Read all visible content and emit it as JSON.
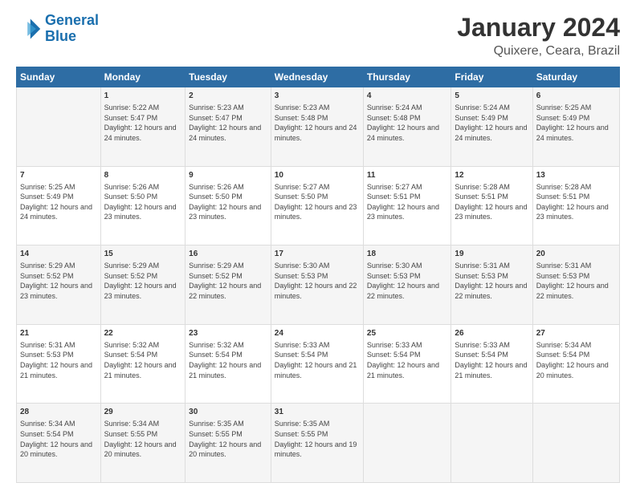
{
  "header": {
    "logo_line1": "General",
    "logo_line2": "Blue",
    "title": "January 2024",
    "subtitle": "Quixere, Ceara, Brazil"
  },
  "columns": [
    "Sunday",
    "Monday",
    "Tuesday",
    "Wednesday",
    "Thursday",
    "Friday",
    "Saturday"
  ],
  "weeks": [
    [
      {
        "day": "",
        "sunrise": "",
        "sunset": "",
        "daylight": ""
      },
      {
        "day": "1",
        "sunrise": "Sunrise: 5:22 AM",
        "sunset": "Sunset: 5:47 PM",
        "daylight": "Daylight: 12 hours and 24 minutes."
      },
      {
        "day": "2",
        "sunrise": "Sunrise: 5:23 AM",
        "sunset": "Sunset: 5:47 PM",
        "daylight": "Daylight: 12 hours and 24 minutes."
      },
      {
        "day": "3",
        "sunrise": "Sunrise: 5:23 AM",
        "sunset": "Sunset: 5:48 PM",
        "daylight": "Daylight: 12 hours and 24 minutes."
      },
      {
        "day": "4",
        "sunrise": "Sunrise: 5:24 AM",
        "sunset": "Sunset: 5:48 PM",
        "daylight": "Daylight: 12 hours and 24 minutes."
      },
      {
        "day": "5",
        "sunrise": "Sunrise: 5:24 AM",
        "sunset": "Sunset: 5:49 PM",
        "daylight": "Daylight: 12 hours and 24 minutes."
      },
      {
        "day": "6",
        "sunrise": "Sunrise: 5:25 AM",
        "sunset": "Sunset: 5:49 PM",
        "daylight": "Daylight: 12 hours and 24 minutes."
      }
    ],
    [
      {
        "day": "7",
        "sunrise": "Sunrise: 5:25 AM",
        "sunset": "Sunset: 5:49 PM",
        "daylight": "Daylight: 12 hours and 24 minutes."
      },
      {
        "day": "8",
        "sunrise": "Sunrise: 5:26 AM",
        "sunset": "Sunset: 5:50 PM",
        "daylight": "Daylight: 12 hours and 23 minutes."
      },
      {
        "day": "9",
        "sunrise": "Sunrise: 5:26 AM",
        "sunset": "Sunset: 5:50 PM",
        "daylight": "Daylight: 12 hours and 23 minutes."
      },
      {
        "day": "10",
        "sunrise": "Sunrise: 5:27 AM",
        "sunset": "Sunset: 5:50 PM",
        "daylight": "Daylight: 12 hours and 23 minutes."
      },
      {
        "day": "11",
        "sunrise": "Sunrise: 5:27 AM",
        "sunset": "Sunset: 5:51 PM",
        "daylight": "Daylight: 12 hours and 23 minutes."
      },
      {
        "day": "12",
        "sunrise": "Sunrise: 5:28 AM",
        "sunset": "Sunset: 5:51 PM",
        "daylight": "Daylight: 12 hours and 23 minutes."
      },
      {
        "day": "13",
        "sunrise": "Sunrise: 5:28 AM",
        "sunset": "Sunset: 5:51 PM",
        "daylight": "Daylight: 12 hours and 23 minutes."
      }
    ],
    [
      {
        "day": "14",
        "sunrise": "Sunrise: 5:29 AM",
        "sunset": "Sunset: 5:52 PM",
        "daylight": "Daylight: 12 hours and 23 minutes."
      },
      {
        "day": "15",
        "sunrise": "Sunrise: 5:29 AM",
        "sunset": "Sunset: 5:52 PM",
        "daylight": "Daylight: 12 hours and 23 minutes."
      },
      {
        "day": "16",
        "sunrise": "Sunrise: 5:29 AM",
        "sunset": "Sunset: 5:52 PM",
        "daylight": "Daylight: 12 hours and 22 minutes."
      },
      {
        "day": "17",
        "sunrise": "Sunrise: 5:30 AM",
        "sunset": "Sunset: 5:53 PM",
        "daylight": "Daylight: 12 hours and 22 minutes."
      },
      {
        "day": "18",
        "sunrise": "Sunrise: 5:30 AM",
        "sunset": "Sunset: 5:53 PM",
        "daylight": "Daylight: 12 hours and 22 minutes."
      },
      {
        "day": "19",
        "sunrise": "Sunrise: 5:31 AM",
        "sunset": "Sunset: 5:53 PM",
        "daylight": "Daylight: 12 hours and 22 minutes."
      },
      {
        "day": "20",
        "sunrise": "Sunrise: 5:31 AM",
        "sunset": "Sunset: 5:53 PM",
        "daylight": "Daylight: 12 hours and 22 minutes."
      }
    ],
    [
      {
        "day": "21",
        "sunrise": "Sunrise: 5:31 AM",
        "sunset": "Sunset: 5:53 PM",
        "daylight": "Daylight: 12 hours and 21 minutes."
      },
      {
        "day": "22",
        "sunrise": "Sunrise: 5:32 AM",
        "sunset": "Sunset: 5:54 PM",
        "daylight": "Daylight: 12 hours and 21 minutes."
      },
      {
        "day": "23",
        "sunrise": "Sunrise: 5:32 AM",
        "sunset": "Sunset: 5:54 PM",
        "daylight": "Daylight: 12 hours and 21 minutes."
      },
      {
        "day": "24",
        "sunrise": "Sunrise: 5:33 AM",
        "sunset": "Sunset: 5:54 PM",
        "daylight": "Daylight: 12 hours and 21 minutes."
      },
      {
        "day": "25",
        "sunrise": "Sunrise: 5:33 AM",
        "sunset": "Sunset: 5:54 PM",
        "daylight": "Daylight: 12 hours and 21 minutes."
      },
      {
        "day": "26",
        "sunrise": "Sunrise: 5:33 AM",
        "sunset": "Sunset: 5:54 PM",
        "daylight": "Daylight: 12 hours and 21 minutes."
      },
      {
        "day": "27",
        "sunrise": "Sunrise: 5:34 AM",
        "sunset": "Sunset: 5:54 PM",
        "daylight": "Daylight: 12 hours and 20 minutes."
      }
    ],
    [
      {
        "day": "28",
        "sunrise": "Sunrise: 5:34 AM",
        "sunset": "Sunset: 5:54 PM",
        "daylight": "Daylight: 12 hours and 20 minutes."
      },
      {
        "day": "29",
        "sunrise": "Sunrise: 5:34 AM",
        "sunset": "Sunset: 5:55 PM",
        "daylight": "Daylight: 12 hours and 20 minutes."
      },
      {
        "day": "30",
        "sunrise": "Sunrise: 5:35 AM",
        "sunset": "Sunset: 5:55 PM",
        "daylight": "Daylight: 12 hours and 20 minutes."
      },
      {
        "day": "31",
        "sunrise": "Sunrise: 5:35 AM",
        "sunset": "Sunset: 5:55 PM",
        "daylight": "Daylight: 12 hours and 19 minutes."
      },
      {
        "day": "",
        "sunrise": "",
        "sunset": "",
        "daylight": ""
      },
      {
        "day": "",
        "sunrise": "",
        "sunset": "",
        "daylight": ""
      },
      {
        "day": "",
        "sunrise": "",
        "sunset": "",
        "daylight": ""
      }
    ]
  ]
}
